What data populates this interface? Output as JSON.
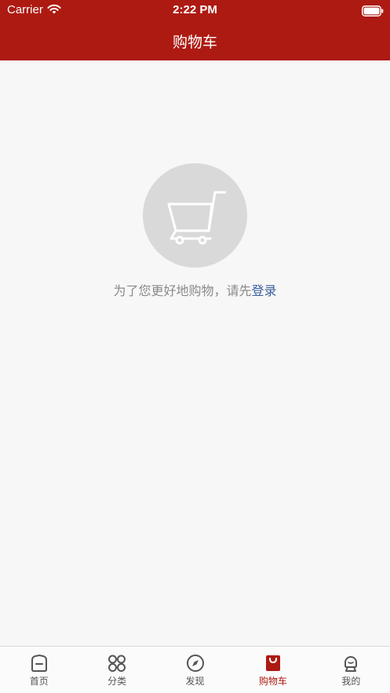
{
  "status_bar": {
    "carrier": "Carrier",
    "time": "2:22 PM",
    "wifi_icon": "wifi-icon",
    "battery_icon": "battery-icon"
  },
  "nav": {
    "title": "购物车"
  },
  "empty_state": {
    "icon": "shopping-cart-icon",
    "message": "为了您更好地购物，请先",
    "login_label": "登录"
  },
  "tabs": [
    {
      "label": "首页",
      "icon": "home-icon",
      "active": false
    },
    {
      "label": "分类",
      "icon": "category-grid-icon",
      "active": false
    },
    {
      "label": "发现",
      "icon": "compass-icon",
      "active": false
    },
    {
      "label": "购物车",
      "icon": "shopping-bag-icon",
      "active": true
    },
    {
      "label": "我的",
      "icon": "profile-icon",
      "active": false
    }
  ],
  "colors": {
    "brand": "#ad1a12",
    "background": "#f7f7f7",
    "link": "#3a5ea0",
    "muted_text": "#8a8a8a"
  }
}
